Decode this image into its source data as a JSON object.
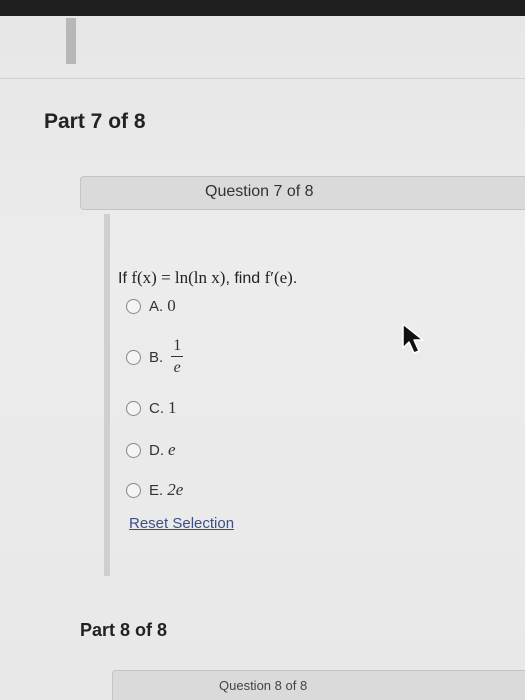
{
  "part7": {
    "title": "Part 7 of 8"
  },
  "question7": {
    "header": "Question 7 of 8",
    "prompt_prefix": "If ",
    "prompt_function": "f(x) = ln(ln x)",
    "prompt_mid": ", find ",
    "prompt_target": "f′(e)",
    "prompt_suffix": ".",
    "options": [
      {
        "letter": "A.",
        "value": "0"
      },
      {
        "letter": "B.",
        "numerator": "1",
        "denominator": "e"
      },
      {
        "letter": "C.",
        "value": "1"
      },
      {
        "letter": "D.",
        "value": "e"
      },
      {
        "letter": "E.",
        "value": "2e"
      }
    ],
    "reset_label": "Reset Selection"
  },
  "part8": {
    "title": "Part 8 of 8"
  },
  "question8": {
    "header": "Question 8 of 8"
  },
  "cursor": {
    "icon": "mouse-pointer-icon"
  }
}
